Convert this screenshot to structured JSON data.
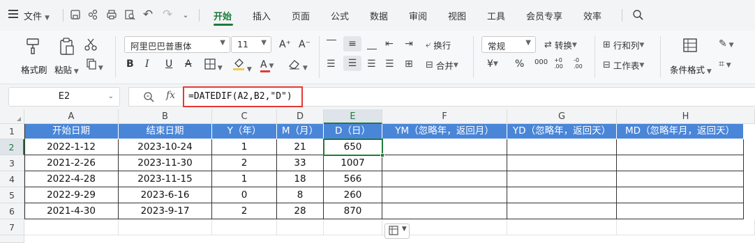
{
  "menu": {
    "file_label": "文件",
    "tabs": [
      "开始",
      "插入",
      "页面",
      "公式",
      "数据",
      "审阅",
      "视图",
      "工具",
      "会员专享",
      "效率"
    ],
    "active_tab": "开始"
  },
  "ribbon": {
    "format_painter": "格式刷",
    "paste": "粘贴",
    "font_name": "阿里巴巴普惠体",
    "font_size": "11",
    "wrap_text": "换行",
    "merge": "合并",
    "number_format": "常规",
    "convert": "转换",
    "rows_cols": "行和列",
    "worksheet": "工作表",
    "conditional_format": "条件格式",
    "bold": "B",
    "italic": "I",
    "underline": "U",
    "strike": "A",
    "font_color_glyph": "A",
    "currency": "¥",
    "percent": "%",
    "thousands": "000",
    "inc_decimal": "+0 .00",
    "dec_decimal": "-0 .00",
    "font_grow": "A⁺",
    "font_shrink": "A⁻"
  },
  "formula_bar": {
    "name_box": "E2",
    "fx_label": "fx",
    "formula": "=DATEDIF(A2,B2,\"D\")"
  },
  "sheet": {
    "column_letters": [
      "A",
      "B",
      "C",
      "D",
      "E",
      "F",
      "G",
      "H"
    ],
    "row_numbers": [
      "1",
      "2",
      "3",
      "4",
      "5",
      "6",
      "7"
    ],
    "headers": [
      "开始日期",
      "结束日期",
      "Y（年）",
      "M（月）",
      "D（日）",
      "YM（忽略年，返回月）",
      "YD（忽略年，返回天）",
      "MD（忽略年月，返回天）"
    ],
    "rows": [
      [
        "2022-1-12",
        "2023-10-24",
        "1",
        "21",
        "650"
      ],
      [
        "2021-2-26",
        "2023-11-30",
        "2",
        "33",
        "1007"
      ],
      [
        "2022-4-28",
        "2023-11-15",
        "1",
        "18",
        "566"
      ],
      [
        "2022-9-29",
        "2023-6-16",
        "0",
        "8",
        "260"
      ],
      [
        "2021-4-30",
        "2023-9-17",
        "2",
        "28",
        "870"
      ]
    ],
    "selected_cell": "E2",
    "colors": {
      "header_fill": "#4a86d8",
      "accent_green": "#1e7b3a",
      "formula_highlight": "#e53935"
    }
  }
}
